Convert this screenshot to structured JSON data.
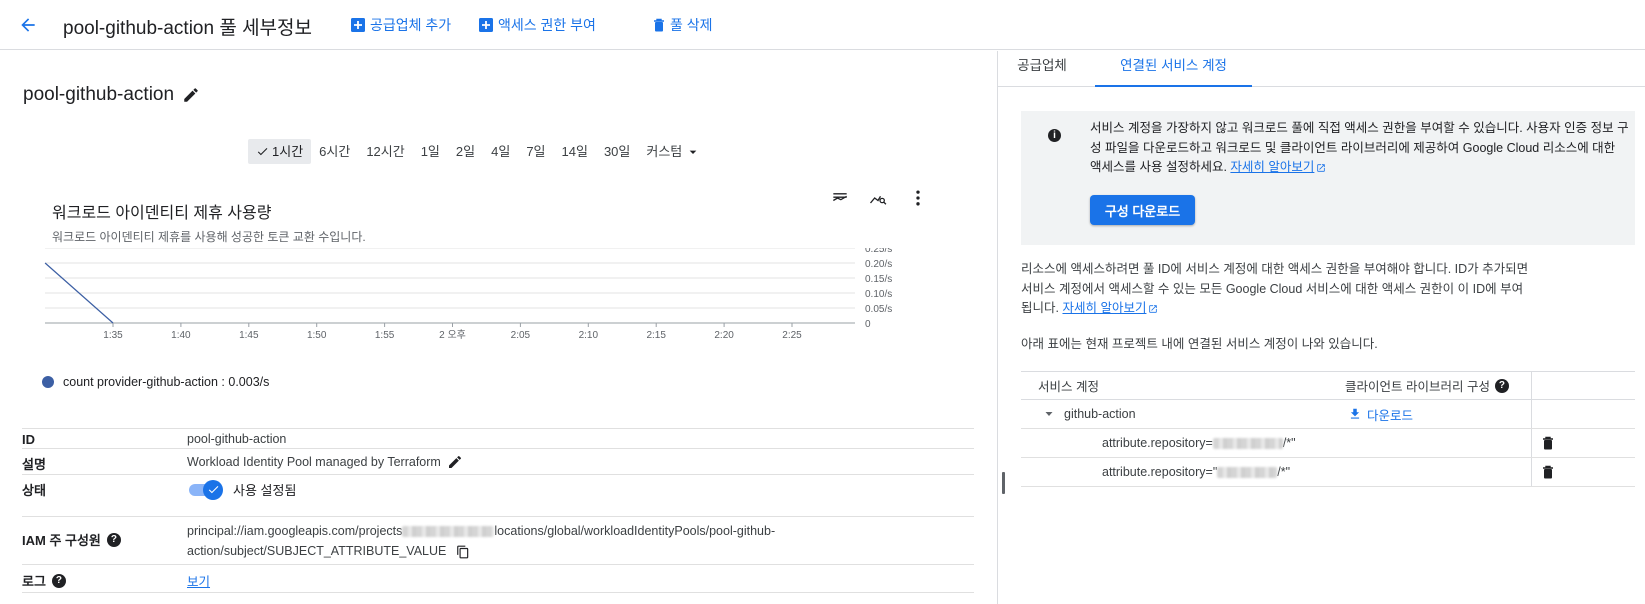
{
  "header": {
    "back_icon": "arrow-back-icon",
    "title": "pool-github-action 풀 세부정보",
    "actions": {
      "add_provider": "공급업체 추가",
      "grant_access": "액세스 권한 부여",
      "delete_pool": "풀 삭제"
    }
  },
  "pool": {
    "name": "pool-github-action"
  },
  "time_range": {
    "options": [
      "1시간",
      "6시간",
      "12시간",
      "1일",
      "2일",
      "4일",
      "7일",
      "14일",
      "30일"
    ],
    "custom": "커스텀",
    "selected": "1시간"
  },
  "chart": {
    "title": "워크로드 아이덴티티 제휴 사용량",
    "subtitle": "워크로드 아이덴티티 제휴를 사용해 성공한 토큰 교환 수입니다.",
    "legend": "count provider-github-action : 0.003/s"
  },
  "chart_data": {
    "type": "line",
    "title": "워크로드 아이덴티티 제휴 사용량",
    "x_ticks": [
      "1:35",
      "1:40",
      "1:45",
      "1:50",
      "1:55",
      "2 오후",
      "2:05",
      "2:10",
      "2:15",
      "2:20",
      "2:25"
    ],
    "y_ticks": [
      "0",
      "0.05/s",
      "0.10/s",
      "0.15/s",
      "0.20/s",
      "0.25/s"
    ],
    "ylim": [
      0,
      0.25
    ],
    "grid": true,
    "legend_position": "bottom-left",
    "series": [
      {
        "name": "count provider-github-action",
        "color": "#3c5fa4",
        "points": [
          {
            "x": "1:30",
            "y": 0.2
          },
          {
            "x": "1:35",
            "y": 0
          }
        ]
      }
    ]
  },
  "properties": {
    "id_label": "ID",
    "id_value": "pool-github-action",
    "desc_label": "설명",
    "desc_value": "Workload Identity Pool managed by Terraform",
    "state_label": "상태",
    "state_value": "사용 설정됨",
    "iam_label": "IAM 주 구성원",
    "iam_value_prefix": "principal://iam.googleapis.com/projects",
    "iam_value_mid": "locations/global/workloadIdentityPools/pool-github-",
    "iam_value_line2": "action/subject/SUBJECT_ATTRIBUTE_VALUE",
    "log_label": "로그",
    "log_link": "보기"
  },
  "right_tabs": {
    "providers": "공급업체",
    "service_accounts": "연결된 서비스 계정"
  },
  "info_box": {
    "text": "서비스 계정을 가장하지 않고 워크로드 풀에 직접 액세스 권한을 부여할 수 있습니다. 사용자 인증 정보 구성 파일을 다운로드하고 워크로드 및 클라이언트 라이브러리에 제공하여 Google Cloud 리소스에 대한 액세스를 사용 설정하세요.",
    "link": "자세히 알아보기",
    "button": "구성 다운로드"
  },
  "para1": {
    "text": "리소스에 액세스하려면 풀 ID에 서비스 계정에 대한 액세스 권한을 부여해야 합니다. ID가 추가되면 서비스 계정에서 액세스할 수 있는 모든 Google Cloud 서비스에 대한 액세스 권한이 이 ID에 부여됩니다.",
    "link": "자세히 알아보기"
  },
  "para2": "아래 표에는 현재 프로젝트 내에 연결된 서비스 계정이 나와 있습니다.",
  "sa_table": {
    "col_account": "서비스 계정",
    "col_client_lib": "클라이언트 라이브러리 구성",
    "group_name": "github-action",
    "download": "다운로드",
    "rows": [
      {
        "prefix": "attribute.repository=",
        "suffix": "/*\""
      },
      {
        "prefix": "attribute.repository=\"",
        "suffix": "/*\""
      }
    ]
  }
}
